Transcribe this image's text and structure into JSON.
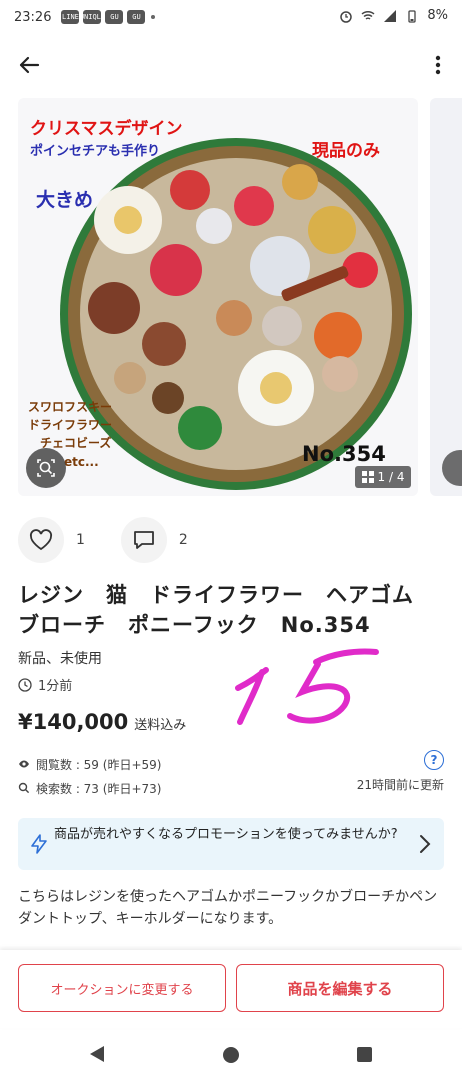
{
  "status_bar": {
    "time": "23:26",
    "app_icons": [
      "LINE",
      "UNIQLO",
      "GU",
      "GU"
    ],
    "battery": "8%"
  },
  "gallery": {
    "image_texts": {
      "christmas": "クリスマスデザイン",
      "poinsettia": "ポインセチアも手作り",
      "in_stock_only": "現品のみ",
      "large": "大きめ",
      "swarovski": "スワロフスキー",
      "dried_flower": "ドライフラワー",
      "czech_beads": "チェコビーズ",
      "etc": "etc...",
      "number": "No.354"
    },
    "page_indicator": "1 / 4"
  },
  "actions": {
    "likes": "1",
    "comments": "2"
  },
  "product": {
    "title": "レジン　猫　ドライフラワー　ヘアゴム　ブローチ　ポニーフック　No.354",
    "condition": "新品、未使用",
    "posted": "1分前",
    "handwritten": "15",
    "price": "¥140,000",
    "shipping": "送料込み",
    "views": "閲覧数 : 59 (昨日+59)",
    "searches": "検索数 : 73 (昨日+73)",
    "updated": "21時間前に更新"
  },
  "promo": {
    "text": "商品が売れやすくなるプロモーションを使ってみませんか?"
  },
  "description": "こちらはレジンを使ったヘアゴムかポニーフックかブローチかペンダントトップ、キーホルダーになります。",
  "buttons": {
    "auction": "オークションに変更する",
    "edit": "商品を編集する"
  },
  "colors": {
    "accent_red": "#e0434b",
    "link_blue": "#2d6fd6",
    "promo_bg": "#eaf5fb"
  },
  "icons": [
    "back-arrow-icon",
    "more-vert-icon",
    "zoom-icon",
    "gallery-grid-icon",
    "heart-icon",
    "comment-icon",
    "clock-icon",
    "eye-icon",
    "search-icon",
    "help-icon",
    "lightning-icon",
    "chevron-right-icon"
  ]
}
